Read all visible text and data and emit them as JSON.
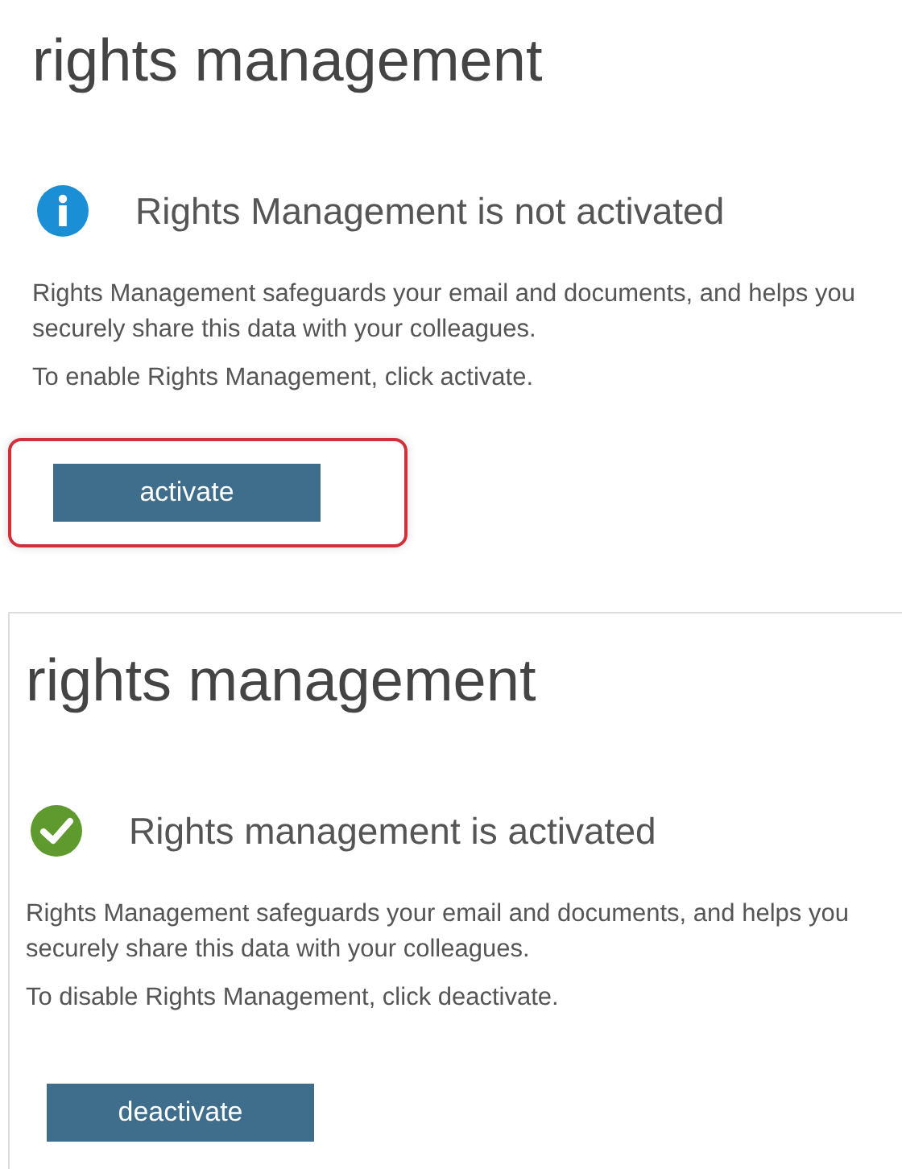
{
  "panels": [
    {
      "title": "rights management",
      "kind": "info",
      "heading": "Rights Management is not activated",
      "description": "Rights Management safeguards your email and documents, and helps you securely share this data with your colleagues.",
      "instruction": "To enable Rights Management, click activate.",
      "button": {
        "label": "activate",
        "highlighted": true
      }
    },
    {
      "title": "rights management",
      "kind": "success",
      "heading": "Rights management is activated",
      "description": "Rights Management safeguards your email and documents, and helps you securely share this data with your colleagues.",
      "instruction": "To disable Rights Management, click deactivate.",
      "button": {
        "label": "deactivate",
        "highlighted": false
      }
    }
  ]
}
